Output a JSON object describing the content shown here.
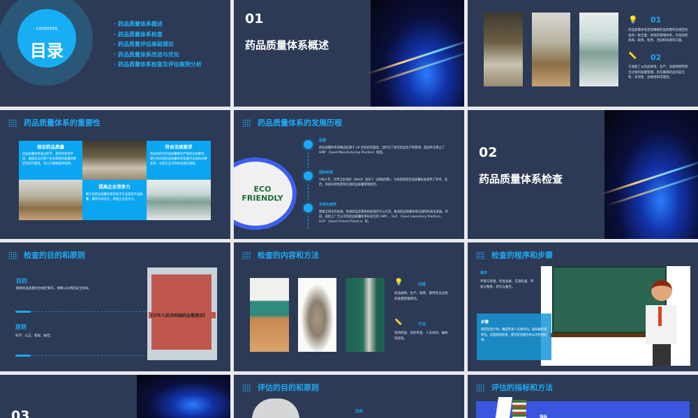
{
  "slides": {
    "toc": {
      "sub": "contents",
      "title": "目录",
      "items": [
        "药品质量体系概述",
        "药品质量体系检查",
        "药品质量评估基础理论",
        "药品质量体系改进与优化",
        "药品质量体系检查及评估案例分析"
      ]
    },
    "sec1": {
      "num": "01",
      "title": "药品质量体系概述"
    },
    "overview": {
      "p1": {
        "num": "01",
        "text": "药品质量体系是指确保药品质量符合规定标准的一套全面、系统的管理体系，包括组织机构、职责、程序、活动和资源等方面。"
      },
      "p2": {
        "num": "02",
        "text": "它涵盖了从药品研发、生产、流通到使用等全过程的质量管理，旨在确保药品的安全性、有效性、合规性和可靠性。"
      }
    },
    "importance": {
      "title": "药品质量体系的重要性",
      "cards": [
        {
          "head": "保证药品质量",
          "text": "药品质量体系通过科学、规范的管理手段，确保药品在整个生命周期内质量的稳定性和可靠性，为公众健康提供保障。"
        },
        {
          "head": "符合法规要求",
          "text": "各国政府对药品质量都有严格的法规要求，建立和实施药品质量体系是遵守法规的必要条件，也是企业可持续发展的基础。"
        },
        {
          "head": "提高企业竞争力",
          "text": "健全的药品质量体系有助于企业提高产品质量，赢得市场信任，增强企业竞争力。"
        }
      ]
    },
    "history": {
      "title": "药品质量体系的发展历程",
      "badge": "ECO FRIENDLY",
      "items": [
        {
          "head": "起源",
          "text": "药品质量体系的概念起源于 20 世纪初的美国，当时为了规范药品生产和管理，美国率先建立了 GMP （Good Manufacturing Practice）制度。"
        },
        {
          "head": "国际标准",
          "text": "1963 年，世界卫生组织（WHO）发布了《国际药典》，为各国制定药品质量标准提供了参考。此后，各国开始制定和实施药品质量管理规范。"
        },
        {
          "head": "全球化趋势",
          "text": "随着全球化的发展，各国药品监管机构加强合作与交流，推动药品质量体系向国际标准化发展。目前，国际上广泛认可的药品质量体系标准包括 GMP 、 GLP （Good Laboratory Practice）、 GCP （Good Clinical Practice）等。"
        }
      ]
    },
    "sec2": {
      "num": "02",
      "title": "药品质量体系检查"
    },
    "purpose": {
      "title": "检查的目的和原则",
      "p1": {
        "head": "目的",
        "text": "确保药品质量符合规定要求，保障公众用药安全有效。"
      },
      "p2": {
        "head": "原则",
        "text": "科学、公正、客观、规范。"
      },
      "sign": "《中华人民共和国药品管理法》"
    },
    "content": {
      "title": "检查的内容和方法",
      "p1": {
        "head": "内容",
        "text": "药品研制、生产、经营、使用等全过程的质量管理情况。"
      },
      "p2": {
        "head": "方法",
        "text": "现场检查、资料审查、人员询问、抽样检验等。"
      }
    },
    "procedure": {
      "title": "检查的程序和步骤",
      "p1": {
        "head": "程序",
        "text": "申请与受理、检查准备、实施检查、审核与整改、结论与报告。"
      },
      "p2": {
        "head": "步骤",
        "text": "制定检查计划，确定检查人员和时间，通知被检查单位，实施现场检查，撰写检查报告并公示检查结果。"
      }
    },
    "sec3": {
      "num": "03"
    },
    "eval_purpose": {
      "title": "评估的目的和原则",
      "p1": "目的"
    },
    "eval_index": {
      "title": "评估的指标和方法",
      "p1": "指标"
    }
  },
  "colors": {
    "bg": "#2c3a55",
    "accent": "#1ea9f3",
    "gap": "#e9e9ee"
  }
}
